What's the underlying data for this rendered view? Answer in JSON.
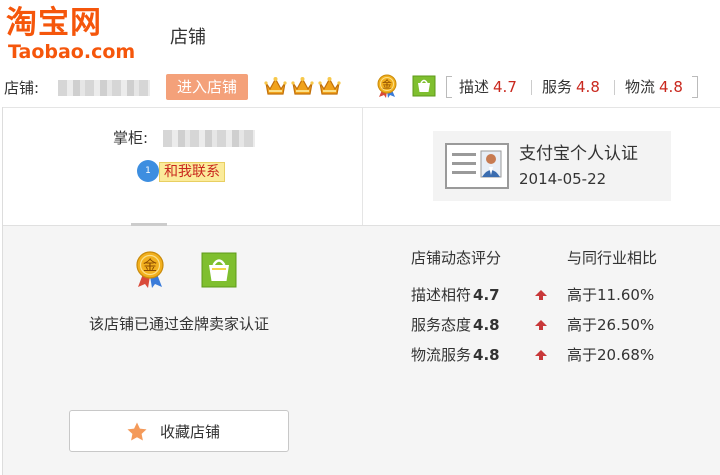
{
  "header": {
    "logo_cn": "淘宝网",
    "logo_en": "Taobao.com",
    "title": "店铺"
  },
  "shop_bar": {
    "shop_label": "店铺:",
    "enter_button": "进入店铺",
    "crown_count": 3,
    "ratings": [
      {
        "label": "描述",
        "value": "4.7"
      },
      {
        "label": "服务",
        "value": "4.8"
      },
      {
        "label": "物流",
        "value": "4.8"
      }
    ]
  },
  "keeper": {
    "label": "掌柜:",
    "contact_bubble": "1",
    "contact_label": "和我联系"
  },
  "certification": {
    "title": "支付宝个人认证",
    "date": "2014-05-22"
  },
  "gold_badge": {
    "icon_text": "金",
    "description": "该店铺已通过金牌卖家认证"
  },
  "dsr": {
    "header_score": "店铺动态评分",
    "header_compare": "与同行业相比",
    "rows": [
      {
        "name": "描述相符",
        "score": "4.7",
        "compare": "高于11.60%"
      },
      {
        "name": "服务态度",
        "score": "4.8",
        "compare": "高于26.50%"
      },
      {
        "name": "物流服务",
        "score": "4.8",
        "compare": "高于20.68%"
      }
    ]
  },
  "favorite": {
    "label": "收藏店铺"
  },
  "colors": {
    "brand": "#f5560b",
    "accent_red": "#c9281e",
    "enter_button": "#f4a17a",
    "panel_bg": "#f5f5f5"
  }
}
